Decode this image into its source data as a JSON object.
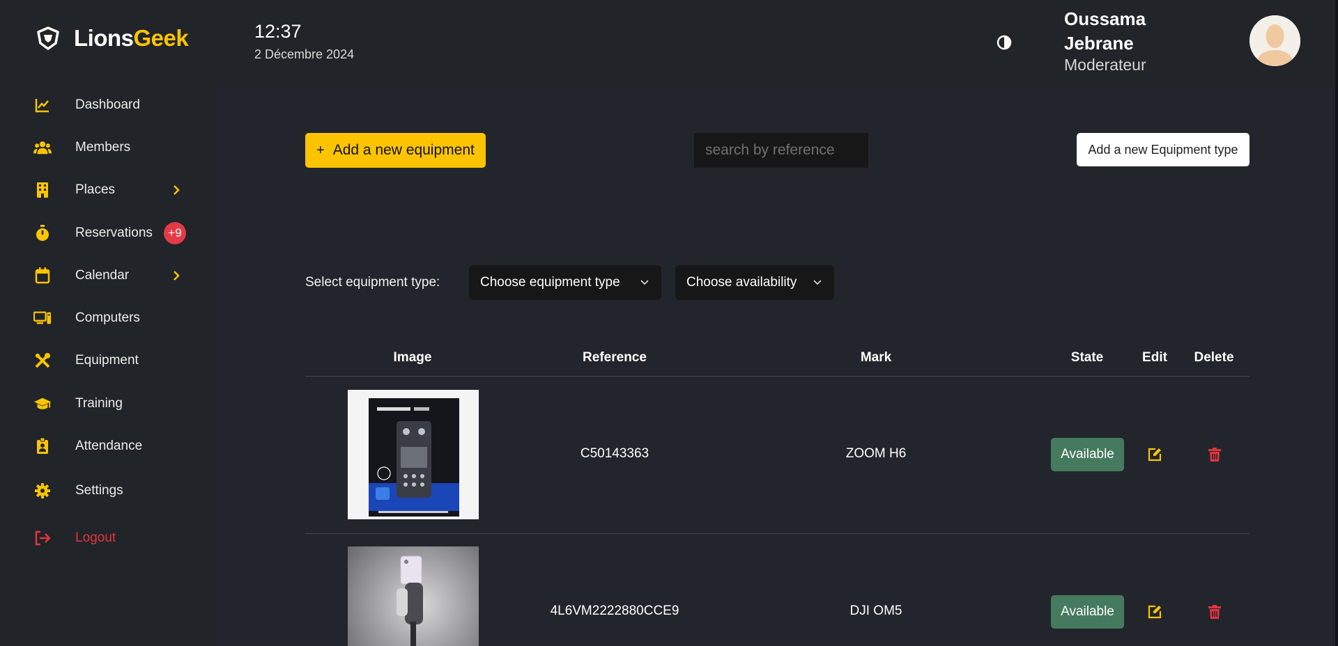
{
  "brand": {
    "part1": "Lions",
    "part2": "Geek"
  },
  "header": {
    "time": "12:37",
    "date": "2 Décembre 2024",
    "user_name": "Oussama Jebrane",
    "user_role": "Moderateur"
  },
  "sidebar": {
    "items": [
      {
        "label": "Dashboard",
        "icon": "chart-line-icon"
      },
      {
        "label": "Members",
        "icon": "users-icon"
      },
      {
        "label": "Places",
        "icon": "building-icon",
        "has_submenu": true
      },
      {
        "label": "Reservations",
        "icon": "stopwatch-icon",
        "badge": "+9"
      },
      {
        "label": "Calendar",
        "icon": "calendar-icon",
        "has_submenu": true
      },
      {
        "label": "Computers",
        "icon": "computer-icon"
      },
      {
        "label": "Equipment",
        "icon": "tools-icon"
      },
      {
        "label": "Training",
        "icon": "graduation-cap-icon"
      },
      {
        "label": "Attendance",
        "icon": "badge-icon"
      },
      {
        "label": "Settings",
        "icon": "gear-icon"
      }
    ],
    "logout_label": "Logout"
  },
  "toolbar": {
    "add_label": "Add a new equipment",
    "search_placeholder": "search by reference",
    "add_type_label": "Add a new Equipment type"
  },
  "filters": {
    "label": "Select equipment type:",
    "type_select": "Choose equipment type",
    "availability_select": "Choose availability"
  },
  "table": {
    "columns": [
      "Image",
      "Reference",
      "Mark",
      "State",
      "Edit",
      "Delete"
    ],
    "rows": [
      {
        "reference": "C50143363",
        "mark": "ZOOM H6",
        "state": "Available",
        "image": "zoom-h6-recorder"
      },
      {
        "reference": "4L6VM2222880CCE9",
        "mark": "DJI OM5",
        "state": "Available",
        "image": "dji-om5-gimbal"
      }
    ]
  },
  "colors": {
    "accent": "#fcc400",
    "background": "#212429",
    "available": "#457a5e",
    "danger": "#e2343f"
  }
}
